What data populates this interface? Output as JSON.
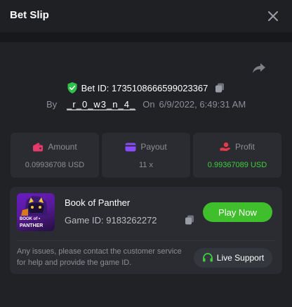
{
  "header": {
    "title": "Bet Slip",
    "close_icon": "close-icon"
  },
  "bet": {
    "id_text": "Bet ID: 1735108666599023367",
    "by_label": "By",
    "username": "_r_0_w3_n_4_",
    "on_label": "On",
    "datetime": "6/9/2022, 6:49:31 AM"
  },
  "stats": {
    "amount": {
      "label": "Amount",
      "value": "0.09936708 USD",
      "icon": "wallet-icon"
    },
    "payout": {
      "label": "Payout",
      "value": "11 x",
      "icon": "card-icon"
    },
    "profit": {
      "label": "Profit",
      "value": "0.99367089 USD",
      "icon": "hand-coin-icon"
    }
  },
  "game": {
    "name": "Book of Panther",
    "id_text": "Game ID: 9183262272",
    "thumb_line1": "BOOK of •",
    "thumb_line2": "PANTHER",
    "play_label": "Play Now"
  },
  "support": {
    "note": "Any issues, please contact the customer service for help and provide the game ID.",
    "button_label": "Live Support"
  },
  "colors": {
    "accent_green": "#3fbf2b",
    "profit_green": "#3fcf3f",
    "amount_pink": "#e8396b",
    "payout_purple": "#8a4bff",
    "profit_red": "#e8394b"
  }
}
